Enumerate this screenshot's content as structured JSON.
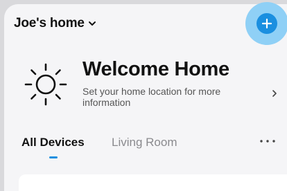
{
  "header": {
    "home_name": "Joe's  home",
    "home_dropdown_icon": "chevron-down-icon",
    "add_icon": "plus-icon",
    "colors": {
      "accent": "#1a8fe0",
      "halo": "#8fd0f6"
    }
  },
  "welcome": {
    "icon": "sun-icon",
    "title": "Welcome Home",
    "subtitle": "Set your home location for more information",
    "arrow_icon": "chevron-right-icon"
  },
  "tabs": {
    "items": [
      {
        "label": "All Devices",
        "selected": true
      },
      {
        "label": "Living Room",
        "selected": false
      }
    ],
    "more_icon": "more-dots-icon"
  }
}
